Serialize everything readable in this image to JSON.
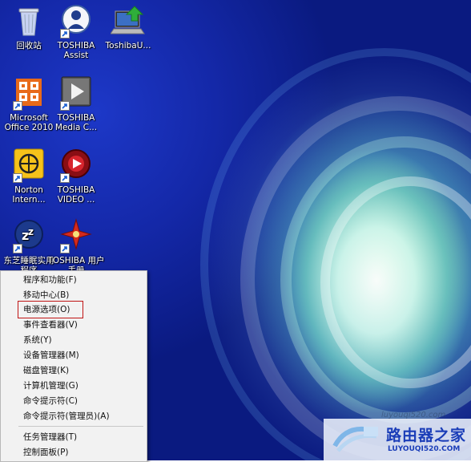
{
  "desktop_icons": [
    {
      "label": "回收站",
      "icon": "recycle-bin-icon",
      "shortcut": false
    },
    {
      "label": "TOSHIBA Assist",
      "icon": "toshiba-assist-icon",
      "shortcut": true
    },
    {
      "label": "ToshibaU...",
      "icon": "toshiba-update-icon",
      "shortcut": false
    },
    {
      "label": "Microsoft Office 2010",
      "icon": "office-icon",
      "shortcut": true
    },
    {
      "label": "TOSHIBA Media C...",
      "icon": "media-controller-icon",
      "shortcut": true
    },
    {
      "label": "Norton Intern...",
      "icon": "norton-icon",
      "shortcut": true
    },
    {
      "label": "TOSHIBA VIDEO ...",
      "icon": "video-player-icon",
      "shortcut": true
    },
    {
      "label": "东芝睡眠实用程序",
      "icon": "sleep-utility-icon",
      "shortcut": true
    },
    {
      "label": "TOSHIBA 用户手册",
      "icon": "user-manual-icon",
      "shortcut": true
    }
  ],
  "context_menu": {
    "group1": [
      "程序和功能(F)",
      "移动中心(B)",
      "电源选项(O)",
      "事件查看器(V)",
      "系统(Y)",
      "设备管理器(M)",
      "磁盘管理(K)",
      "计算机管理(G)",
      "命令提示符(C)",
      "命令提示符(管理员)(A)"
    ],
    "group2": [
      "任务管理器(T)",
      "控制面板(P)"
    ],
    "highlighted": "电源选项(O)"
  },
  "watermark": {
    "title": "路由器之家",
    "url": "LUYOUQI520.COM",
    "faint_text": "luyouqi520.com"
  },
  "colors": {
    "highlight_border": "#c01414",
    "menu_background": "#f2f2f2",
    "watermark_text": "#1a3db8"
  }
}
